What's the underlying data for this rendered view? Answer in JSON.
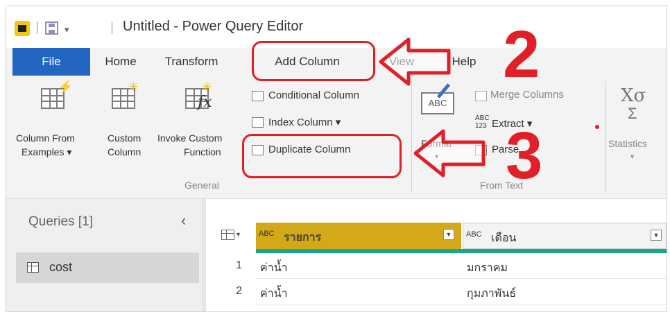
{
  "window": {
    "title": "Untitled - Power Query Editor"
  },
  "tabs": [
    "File",
    "Home",
    "Transform",
    "Add Column",
    "View",
    "Help"
  ],
  "ribbon": {
    "general": {
      "column_from_examples": [
        "Column From",
        "Examples ▾"
      ],
      "custom_column": [
        "Custom",
        "Column"
      ],
      "invoke_custom_function": [
        "Invoke Custom",
        "Function"
      ],
      "conditional_column": "Conditional Column",
      "index_column": "Index Column ▾",
      "duplicate_column": "Duplicate Column",
      "group_label": "General"
    },
    "from_text": {
      "format": "Format",
      "format_caret": "▾",
      "merge_columns": "Merge Columns",
      "extract": "Extract ▾",
      "parse": "Parse",
      "group_label": "From Text"
    },
    "statistics": "Statistics",
    "statistics_caret": "▾"
  },
  "queries": {
    "title": "Queries [1]",
    "items": [
      "cost"
    ]
  },
  "table": {
    "columns": [
      {
        "type": "ABC",
        "name": "รายการ"
      },
      {
        "type": "ABC",
        "name": "เดือน"
      }
    ],
    "rows": [
      {
        "n": "1",
        "c1": "ค่าน้ำ",
        "c2": "มกราคม"
      },
      {
        "n": "2",
        "c1": "ค่าน้ำ",
        "c2": "กุมภาพันธ์"
      }
    ]
  },
  "annotations": {
    "step_a": "2",
    "step_b": "3"
  },
  "colors": {
    "file_tab": "#2366c2",
    "annotation": "#e01f26",
    "header_gold": "#d4a919",
    "teal": "#1aa58f"
  }
}
